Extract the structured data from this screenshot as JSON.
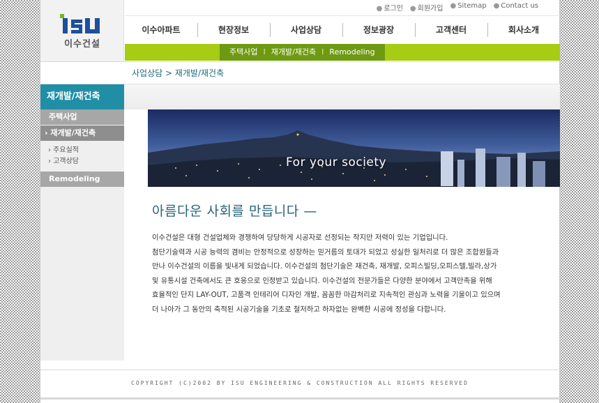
{
  "logo": {
    "mark": "ISU",
    "name": "이수건설"
  },
  "util_links": [
    "로그인",
    "회원가입",
    "Sitemap",
    "Contact us"
  ],
  "gnb": [
    "이수아파트",
    "현장정보",
    "사업상담",
    "정보광장",
    "고객센터",
    "회사소개"
  ],
  "subnav": [
    "주택사업",
    "재개발/재건축",
    "Remodeling"
  ],
  "breadcrumb": "사업상담 > 재개발/재건축",
  "lnb": {
    "title": "재개발/재건축",
    "items": [
      {
        "label": "주택사업"
      },
      {
        "label": "› 재개발/재건축"
      },
      {
        "label": "Remodeling"
      }
    ],
    "sub": [
      "› 주요실적",
      "› 고객상담"
    ]
  },
  "visual": {
    "caption": "For your society"
  },
  "headline": "아름다운 사회를 만듭니다 —",
  "body": [
    "이수건설은 대형 건설업체와 경쟁하여 당당하게 시공자로 선정되는 작지만 저력이 있는 기업입니다.",
    "첨단기술력과 시공 능력의 겸비는 안정적으로 성장하는 믿거름의 토대가 되었고 성실한 일처리로 더 많은 조합원들과",
    "만나 이수건설의 이름을 빛내게 되었습니다. 이수건설의 첨단기술은 재건축, 재개발, 오피스빌딩,오피스텔,빌라,상가",
    "및 유통시설 건축에서도 큰 호응으로 인정받고 있습니다. 이수건설의 전문가들은 다양한 분야에서 고객만족을 위해",
    "효율적인 단지 LAY-OUT, 고품격 인테리어 디자인 개발, 꼼꼼한 마감처리로 지속적인 관심과 노력을 기울이고 있으며",
    "더 나아가 그 동안의 축적된 시공기술을 기초로 철저하고 하자없는 완벽한 시공에 정성을 다합니다."
  ],
  "footer": "COPYRIGHT (C)2002 BY ISU ENGINEERING & CONSTRUCTION ALL RIGHTS RESERVED",
  "colors": {
    "teal": "#208fa6",
    "lime": "#a6cc13",
    "dark_green": "#6e9a12"
  }
}
